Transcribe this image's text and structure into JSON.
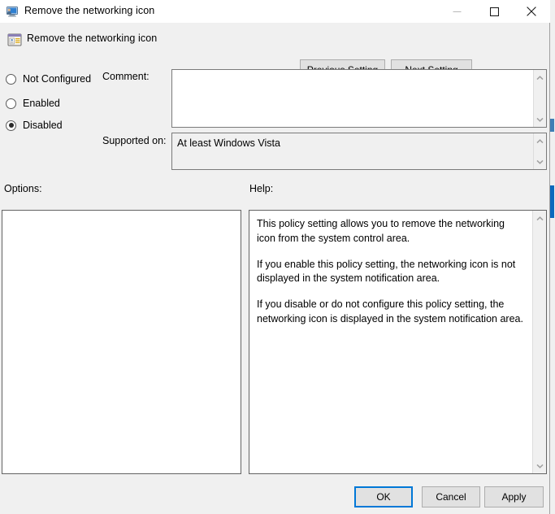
{
  "window": {
    "title": "Remove the networking icon",
    "title_icon": "monitor-user-icon",
    "controls": {
      "minimize": "minimize-icon",
      "maximize": "maximize-icon",
      "close": "close-icon"
    }
  },
  "header": {
    "icon": "policy-setting-icon",
    "title": "Remove the networking icon",
    "previous_label": "Previous Setting",
    "next_label": "Next Setting"
  },
  "state": {
    "options": [
      {
        "label": "Not Configured",
        "selected": false
      },
      {
        "label": "Enabled",
        "selected": false
      },
      {
        "label": "Disabled",
        "selected": true
      }
    ]
  },
  "comment": {
    "label": "Comment:",
    "value": "",
    "placeholder": ""
  },
  "supported_on": {
    "label": "Supported on:",
    "value": "At least Windows Vista"
  },
  "options_panel": {
    "label": "Options:",
    "content": ""
  },
  "help_panel": {
    "label": "Help:",
    "paragraphs": [
      "This policy setting allows you to remove the networking icon from the system control area.",
      "If you enable this policy setting, the networking icon is not displayed in the system notification area.",
      "If you disable or do not configure this policy setting, the networking icon is displayed in the system notification area."
    ]
  },
  "footer": {
    "ok_label": "OK",
    "cancel_label": "Cancel",
    "apply_label": "Apply"
  },
  "colors": {
    "window_bg": "#f0f0f0",
    "titlebar_bg": "#ffffff",
    "field_bg": "#ffffff",
    "readonly_bg": "#f0f0f0",
    "button_bg": "#e1e1e1",
    "button_border": "#adadad",
    "focus_accent": "#0078d7",
    "panel_border": "#646464",
    "text": "#000000"
  }
}
